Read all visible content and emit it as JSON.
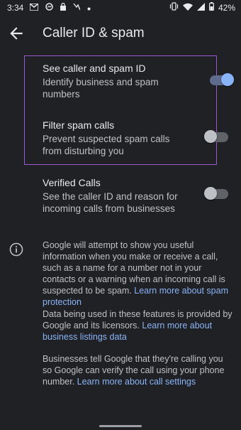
{
  "status_bar": {
    "time": "3:34",
    "left_icons": [
      "gmail-icon",
      "messenger-icon",
      "lock-icon",
      "missed-call-icon",
      "dot-icon"
    ],
    "right_icons": [
      "vibrate-icon",
      "wifi-icon",
      "signal-icon",
      "battery-icon"
    ],
    "battery": "42%"
  },
  "app_bar": {
    "title": "Caller ID & spam"
  },
  "settings": [
    {
      "title": "See caller and spam ID",
      "subtitle": "Identify business and spam numbers",
      "enabled": true
    },
    {
      "title": "Filter spam calls",
      "subtitle": "Prevent suspected spam calls from disturbing you",
      "enabled": false
    },
    {
      "title": "Verified Calls",
      "subtitle": "See the caller ID and reason for incoming calls from businesses",
      "enabled": false
    }
  ],
  "info": {
    "para1_text": "Google will attempt to show you useful information when you make or receive a call, such as a name for a number not in your contacts or a warning when an incoming call is suspected to be spam.",
    "para1_link": "Learn more about spam protection",
    "para2_text": "Data being used in these features is provided by Google and its licensors.",
    "para2_link": "Learn more about business listings data",
    "para3_text": "Businesses tell Google that they're calling you so Google can verify the call using your phone number.",
    "para3_link": "Learn more about call settings"
  },
  "colors": {
    "background": "#202124",
    "accent": "#8ab4f8",
    "highlight_border": "#9b59d0"
  }
}
